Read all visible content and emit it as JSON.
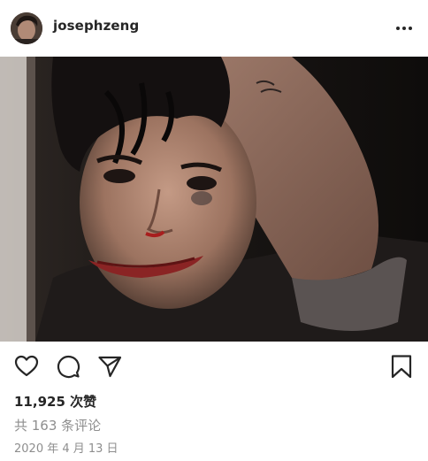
{
  "post": {
    "username": "josephzeng",
    "likes_text": "11,925 次赞",
    "comments_text": "共 163 条评论",
    "date_text": "2020 年 4 月 13 日"
  },
  "icons": {
    "more": "more-horizontal-icon",
    "like": "heart-icon",
    "comment": "comment-icon",
    "share": "paper-plane-icon",
    "save": "bookmark-icon"
  },
  "colors": {
    "text": "#262626",
    "muted": "#8e8e8e",
    "background": "#ffffff"
  }
}
